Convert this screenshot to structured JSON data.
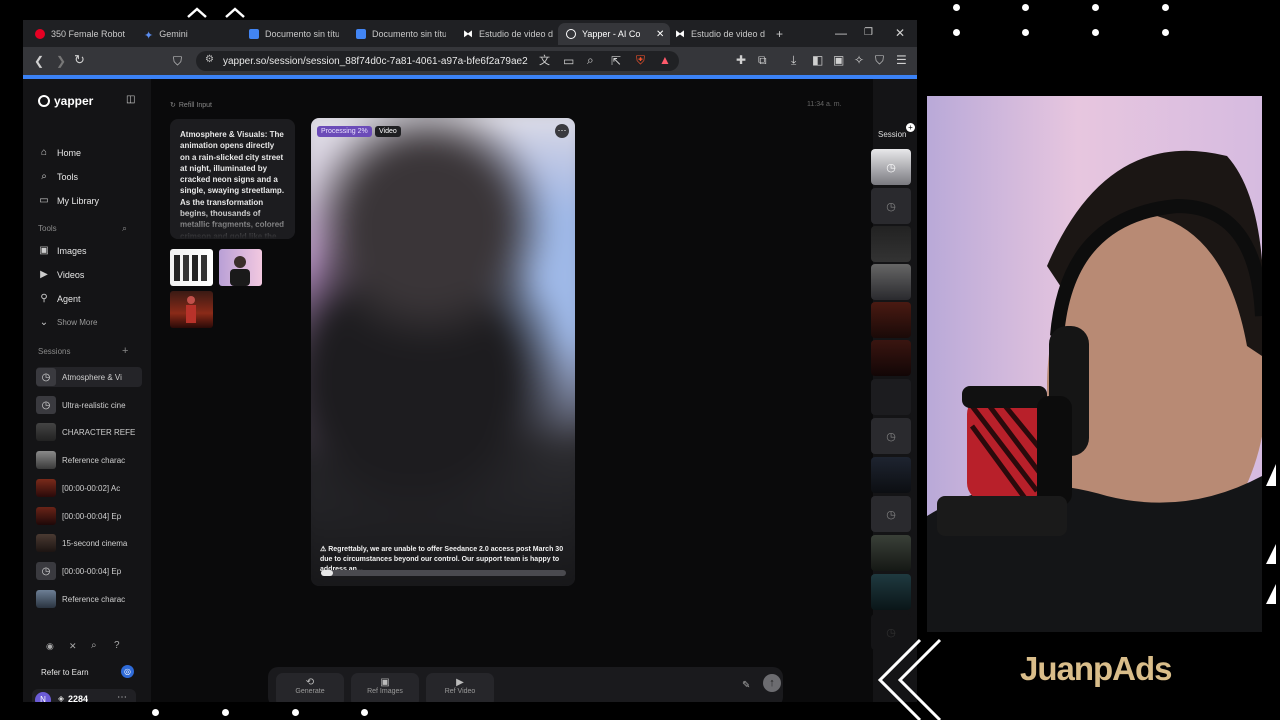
{
  "browser": {
    "tabs": [
      {
        "title": "350 Female Robot",
        "color": "#e60023",
        "active": false
      },
      {
        "title": "Gemini",
        "color": "#5b8def",
        "active": false
      },
      {
        "title": "Documento sin título",
        "color": "#4285f4",
        "active": false
      },
      {
        "title": "Documento sin título",
        "color": "#4285f4",
        "active": false
      },
      {
        "title": "Estudio de video de",
        "color": "#ffffff",
        "active": false
      },
      {
        "title": "Yapper - AI Co",
        "color": "#ffffff",
        "active": true
      },
      {
        "title": "Estudio de video de",
        "color": "#ffffff",
        "active": false
      }
    ],
    "new_tab": "+",
    "url": "yapper.so/session/session_88f74d0c-7a81-4061-a97a-bfe6f2a79ae2"
  },
  "sidebar": {
    "brand": "yapper",
    "nav": [
      {
        "label": "Home",
        "icon": "home-icon"
      },
      {
        "label": "Tools",
        "icon": "tools-icon"
      },
      {
        "label": "My Library",
        "icon": "folder-icon"
      }
    ],
    "tools_heading": "Tools",
    "tools": [
      {
        "label": "Images",
        "icon": "image-icon"
      },
      {
        "label": "Videos",
        "icon": "video-icon"
      },
      {
        "label": "Agent",
        "icon": "agent-icon"
      },
      {
        "label": "Show More",
        "icon": "chevron-down-icon"
      }
    ],
    "sessions_heading": "Sessions",
    "sessions": [
      {
        "label": "Atmosphere & Vi",
        "thumb": "clock",
        "active": true
      },
      {
        "label": "Ultra-realistic cine",
        "thumb": "clock",
        "active": false
      },
      {
        "label": "CHARACTER REFE",
        "thumb": "image",
        "active": false
      },
      {
        "label": "Reference charac",
        "thumb": "image",
        "active": false
      },
      {
        "label": "[00:00-00:02] Ac",
        "thumb": "image",
        "active": false
      },
      {
        "label": "[00:00-00:04] Ep",
        "thumb": "image",
        "active": false
      },
      {
        "label": "15-second cinema",
        "thumb": "image",
        "active": false
      },
      {
        "label": "[00:00-00:04] Ep",
        "thumb": "clock",
        "active": false
      },
      {
        "label": "Reference charac",
        "thumb": "image",
        "active": false
      }
    ],
    "refer_label": "Refer to Earn",
    "user_initial": "N",
    "credits": "2284"
  },
  "main": {
    "refill_label": "Refill Input",
    "timestamp": "11:34 a. m.",
    "prompt_text": "Atmosphere & Visuals: The animation opens directly on a rain-slicked city street at night, illuminated by cracked neon signs and a single, swaying streetlamp. As the transformation begins, thousands of metallic fragments, colored crimson and gold like the armor in",
    "video_card": {
      "status_badge": "Processing 2%",
      "type_badge": "Video",
      "progress": 0.05,
      "message": "Regrettably, we are unable to offer Seedance 2.0 access post March 30 due to circumstances beyond our control. Our support team is happy to address an..."
    },
    "composer_buttons": [
      "Generate",
      "Ref Images",
      "Ref Video"
    ]
  },
  "right_panel": {
    "label": "Session"
  },
  "overlay": {
    "brand_text": "JuanpAds"
  }
}
